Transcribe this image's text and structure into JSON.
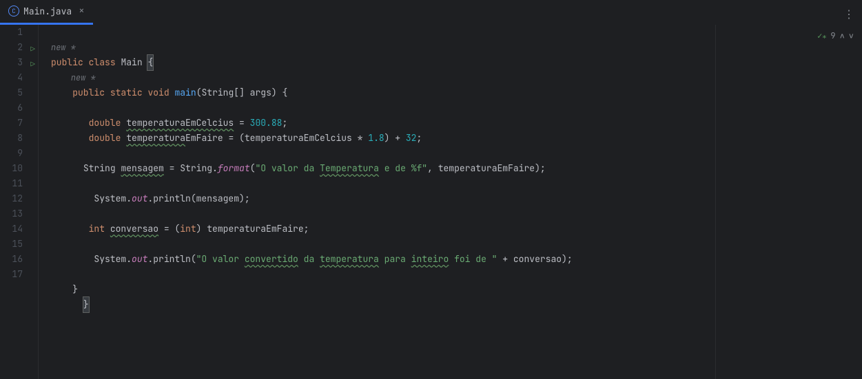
{
  "tab": {
    "filename": "Main.java",
    "icon_letter": "C"
  },
  "status": {
    "count": "9"
  },
  "annotations": {
    "new_star": "new *"
  },
  "code": {
    "l2": {
      "kw1": "public",
      "kw2": "class",
      "name": "Main",
      "brace": "{"
    },
    "l3": {
      "kw1": "public",
      "kw2": "static",
      "kw3": "void",
      "method": "main",
      "params": "(String[] args) {"
    },
    "l5": {
      "kw": "double",
      "var": "temperaturaEmCelcius",
      "eq": " = ",
      "val": "300.88",
      "semi": ";"
    },
    "l6": {
      "kw": "double",
      "var": "temperaturaEmFaire",
      "rest": " = (temperaturaEmCelcius * ",
      "n1": "1.8",
      "mid": ") + ",
      "n2": "32",
      "semi": ";"
    },
    "l8": {
      "type": "String",
      "var": "mensagem",
      "eq": " = String.",
      "fmt": "format",
      "open": "(",
      "str1": "\"O valor da ",
      "str2": "Temperatura",
      "str3": " e de %f\"",
      "rest": ", temperaturaEmFaire);"
    },
    "l10": {
      "pre": " System.",
      "out": "out",
      "rest": ".println(mensagem);"
    },
    "l12": {
      "kw": "int",
      "var": "conversao",
      "eq": " = (",
      "cast": "int",
      "rest": ") temperaturaEmFaire;"
    },
    "l14": {
      "pre": " System.",
      "out": "out",
      "mid": ".println(",
      "str1": "\"O valor ",
      "str2": "convertido",
      "str3": " da ",
      "str4": "temperatura",
      "str5": " para ",
      "str6": "inteiro",
      "str7": " foi de \"",
      "rest": " + conversao);"
    },
    "l16": {
      "brace": "}"
    },
    "l17": {
      "brace": "}"
    }
  },
  "lines": [
    "1",
    "2",
    "3",
    "4",
    "5",
    "6",
    "7",
    "8",
    "9",
    "10",
    "11",
    "12",
    "13",
    "14",
    "15",
    "16",
    "17"
  ]
}
